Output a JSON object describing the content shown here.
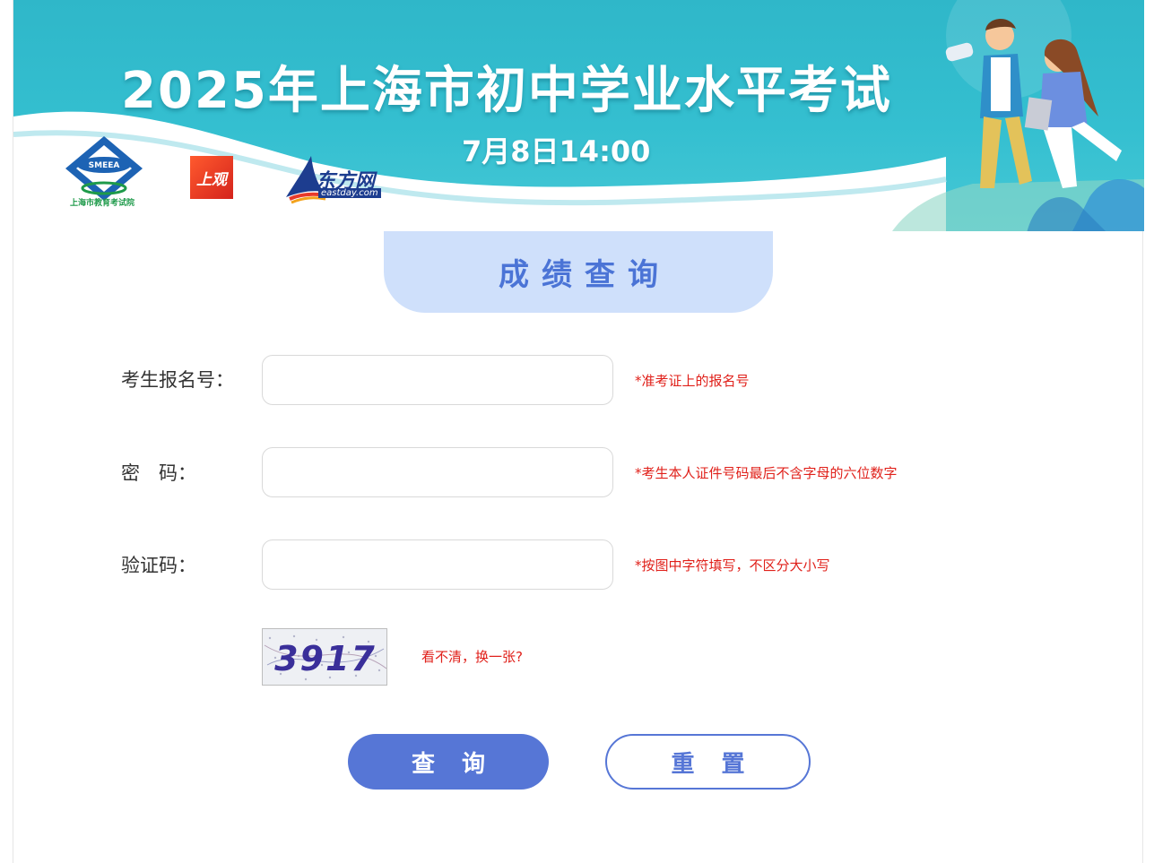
{
  "banner": {
    "title": "2025年上海市初中学业水平考试",
    "date": "7月8日14:00",
    "logos": {
      "smeea_mark": "SMEEA",
      "smeea_name": "上海市教育考试院",
      "shangguan": "上观",
      "eastday_cn": "东方网",
      "eastday_en": "eastday.com"
    }
  },
  "section_title": "成绩查询",
  "form": {
    "fields": [
      {
        "label": "考生报名号：",
        "value": "",
        "hint": "*准考证上的报名号"
      },
      {
        "label": "密　码：",
        "value": "",
        "hint": "*考生本人证件号码最后不含字母的六位数字"
      },
      {
        "label": "验证码：",
        "value": "",
        "hint": "*按图中字符填写，不区分大小写"
      }
    ],
    "captcha_text": "3917",
    "refresh_label": "看不清，换一张?"
  },
  "buttons": {
    "query": "查询",
    "reset": "重置"
  },
  "colors": {
    "banner_bg": "#34bfd0",
    "accent": "#5676d6",
    "tab_bg": "#cfe0fb",
    "hint": "#e0201a"
  }
}
